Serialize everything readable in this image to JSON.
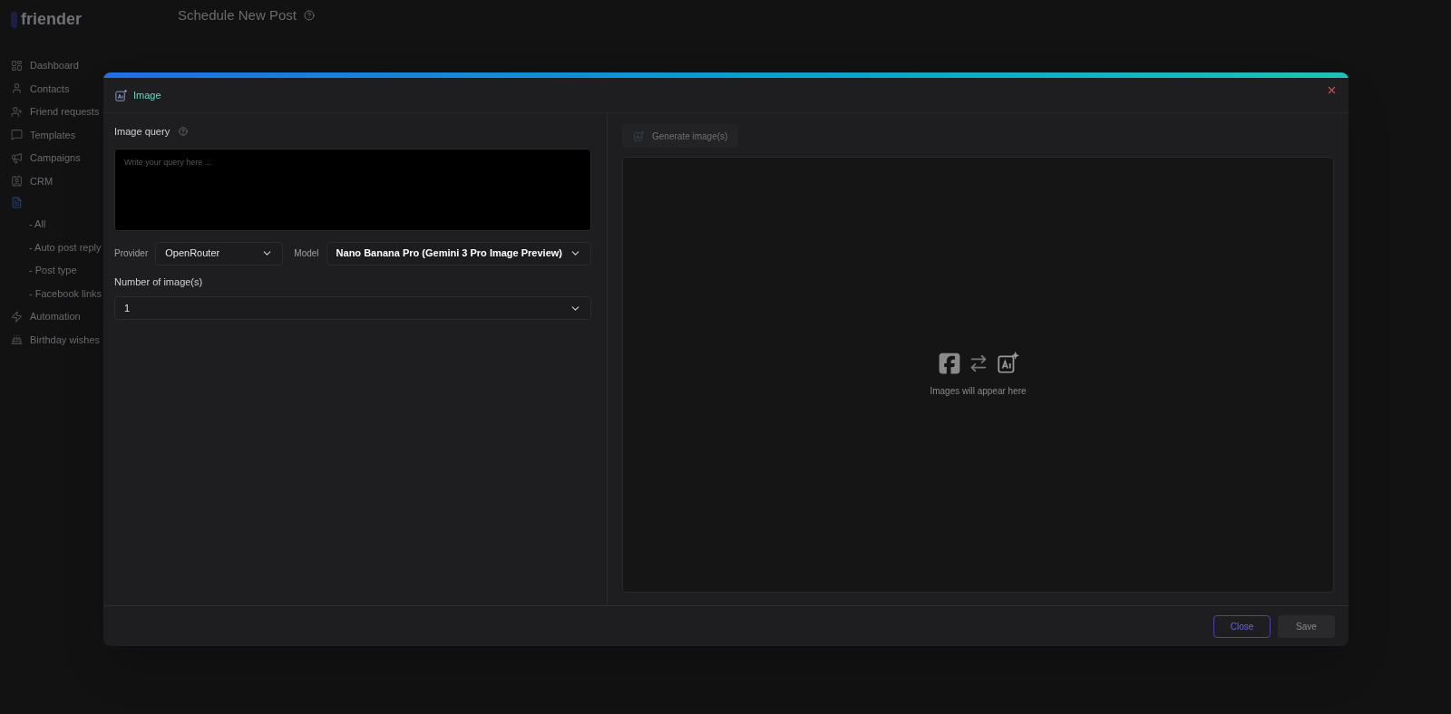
{
  "app": {
    "logo": "friender",
    "page_title": "Schedule New Post",
    "sidebar": {
      "items": [
        {
          "label": "Dashboard"
        },
        {
          "label": "Contacts"
        },
        {
          "label": "Friend requests"
        },
        {
          "label": "Templates"
        },
        {
          "label": "Campaigns"
        },
        {
          "label": "CRM"
        },
        {
          "children": [
            {
              "label": "- All"
            },
            {
              "label": "- Auto post reply"
            },
            {
              "label": "- Post type"
            },
            {
              "label": "- Facebook links"
            }
          ]
        },
        {
          "label": "Automation"
        },
        {
          "label": "Birthday wishes"
        }
      ]
    }
  },
  "dialog": {
    "title": "Image",
    "query": {
      "label": "Image query",
      "placeholder": "Write your query here ..."
    },
    "provider": {
      "label": "Provider",
      "value": "OpenRouter"
    },
    "model": {
      "label": "Model",
      "value": "Nano Banana Pro (Gemini 3 Pro Image Preview)"
    },
    "count": {
      "label": "Number of image(s)",
      "value": "1"
    },
    "generate_button": {
      "label": "Generate image(s)",
      "disabled": true
    },
    "preview": {
      "message": "Images will appear here"
    },
    "buttons": [
      {
        "label": "Close",
        "kind": "secondary"
      },
      {
        "label": "Save",
        "kind": "primary"
      }
    ]
  }
}
